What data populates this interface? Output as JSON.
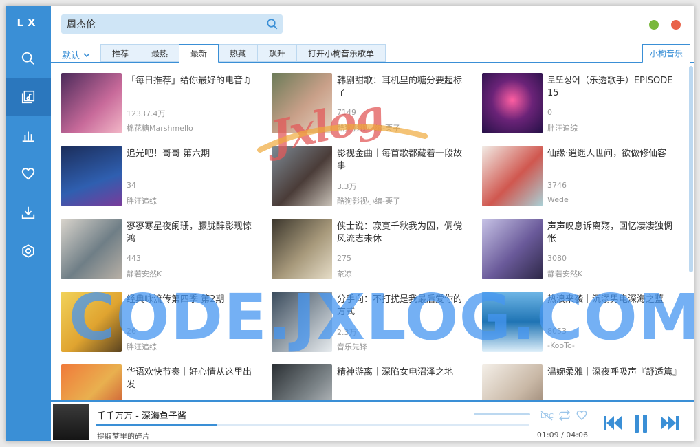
{
  "app": {
    "logo": "LX"
  },
  "sidebar": {
    "items": [
      {
        "name": "search",
        "icon": "search-icon"
      },
      {
        "name": "songlist",
        "icon": "songlist-icon",
        "active": true
      },
      {
        "name": "leaderboard",
        "icon": "chart-icon"
      },
      {
        "name": "favorites",
        "icon": "heart-icon"
      },
      {
        "name": "download",
        "icon": "download-icon"
      },
      {
        "name": "settings",
        "icon": "settings-icon"
      }
    ]
  },
  "search": {
    "value": "周杰伦"
  },
  "window_controls": {
    "min_color": "#7ab83c",
    "close_color": "#e9634a"
  },
  "tabs": {
    "sort_label": "默认",
    "items": [
      "推荐",
      "最热",
      "最新",
      "热藏",
      "飙升",
      "打开小枸音乐歌单"
    ],
    "active": "最新",
    "source_label": "小枸音乐"
  },
  "playlists": [
    {
      "title": "「每日推荐」给你最好的电音♫",
      "plays": "12337.4万",
      "author": "棉花糖Marshmello"
    },
    {
      "title": "韩剧甜歌：耳机里的糖分要超标了",
      "plays": "7149",
      "author": "酷狗影视小编-栗子"
    },
    {
      "title": "로또싱어（乐透歌手）EPISODE 15",
      "plays": "0",
      "author": "胖汪追综"
    },
    {
      "title": "追光吧！哥哥 第六期",
      "plays": "34",
      "author": "胖汪追综"
    },
    {
      "title": "影视金曲｜每首歌都藏着一段故事",
      "plays": "3.3万",
      "author": "酷狗影视小编-栗子"
    },
    {
      "title": "仙缘·逍遥人世间，欲做修仙客",
      "plays": "3746",
      "author": "Wede"
    },
    {
      "title": "寥寥寒星夜阑珊，朦胧醉影现惊鸿",
      "plays": "443",
      "author": "静若安然K"
    },
    {
      "title": "侠士说：寂寞千秋我为囚，倜傥风流志未休",
      "plays": "275",
      "author": "茶凉"
    },
    {
      "title": "声声叹息诉离殇，回忆凄凄独惆怅",
      "plays": "3080",
      "author": "静若安然K"
    },
    {
      "title": "经典咏流传第四季 第2期",
      "plays": "26",
      "author": "胖汪追综"
    },
    {
      "title": "分手向：不打扰是我最后爱你的方式",
      "plays": "2.3万",
      "author": "音乐先锋"
    },
    {
      "title": "热浪来袭｜沉溺男电深海之蓝",
      "plays": "8053",
      "author": "-KooTo-"
    },
    {
      "title": "华语欢快节奏｜好心情从这里出发",
      "plays": "",
      "author": ""
    },
    {
      "title": "精神游离｜深陷女电沼泽之地",
      "plays": "",
      "author": ""
    },
    {
      "title": "温婉柔雅｜深夜呼吸声『舒适篇』",
      "plays": "",
      "author": ""
    }
  ],
  "player": {
    "title": "千千万万 - 深海鱼子酱",
    "lyric": "提取梦里的碎片",
    "current_time": "01:09",
    "separator": "/",
    "duration": "04:06",
    "progress": 0.28
  },
  "watermarks": {
    "top": "Jxlog",
    "bottom": "CODE.JXLOG.COM"
  },
  "colors": {
    "accent": "#3a8fd6",
    "sidebar_active": "#2b77bd"
  }
}
